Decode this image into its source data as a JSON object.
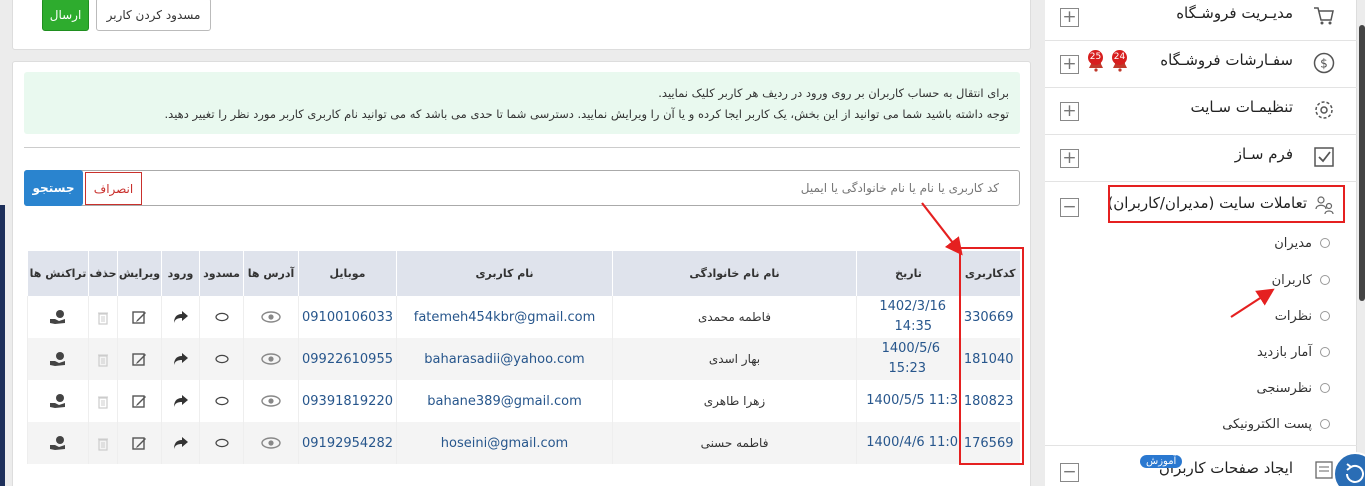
{
  "top": {
    "send_label": "ارسال",
    "block_label": "مسدود کردن کاربر"
  },
  "alert": {
    "line1": "برای انتقال به حساب کاربران بر روی ورود در ردیف هر کاربر کلیک نمایید.",
    "line2": "توجه داشته باشید شما می توانید از این بخش، یک کاربر ایجا کرده و یا آن را ویرایش نمایید. دسترسی شما تا حدی می باشد که می توانید نام کاربری کاربر مورد نظر را تغییر دهید."
  },
  "search": {
    "placeholder": "کد کاربری یا نام یا نام خانوادگی یا ایمیل",
    "cancel_label": "انصراف",
    "search_label": "جستجو"
  },
  "table": {
    "headers": [
      "کدکاربری",
      "تاریخ",
      "نام نام خانوادگی",
      "نام کاربری",
      "موبایل",
      "آدرس ها",
      "مسدود",
      "ورود",
      "ویرایش",
      "حذف",
      "تراکنش ها"
    ],
    "rows": [
      {
        "code": "330669",
        "date1": "1402/3/16",
        "date2": "14:35",
        "name": "فاطمه محمدی",
        "username": "fatemeh454kbr@gmail.com",
        "mobile": "09100106033"
      },
      {
        "code": "181040",
        "date1": "1400/5/6",
        "date2": "15:23",
        "name": "بهار اسدی",
        "username": "baharasadii@yahoo.com",
        "mobile": "09922610955"
      },
      {
        "code": "180823",
        "date1": "11:3 1400/5/5",
        "date2": "",
        "name": "زهرا طاهری",
        "username": "bahane389@gmail.com",
        "mobile": "09391819220"
      },
      {
        "code": "176569",
        "date1": "11:0 1400/4/6",
        "date2": "",
        "name": "فاطمه حسنی",
        "username": "hoseini@gmail.com",
        "mobile": "09192954282"
      }
    ]
  },
  "sidebar": {
    "items": [
      {
        "label": "مدیـریت فروشـگاه"
      },
      {
        "label": "سفـارشات فروشـگاه",
        "badge1": "24",
        "badge2": "25"
      },
      {
        "label": "تنظیمـات سـایت"
      },
      {
        "label": "فرم سـاز"
      },
      {
        "label": "تعاملات سایت (مدیران/کاربران)"
      }
    ],
    "sub_items": [
      "مدیران",
      "کاربران",
      "نظرات",
      "آمار بازدید",
      "نظرسنجی",
      "پست الکترونیکی"
    ],
    "last_item": {
      "label": "ایجاد صفحات کاربران",
      "badge": "آموزش"
    }
  },
  "colors": {
    "accent": "#2a84cf",
    "success": "#2eac2e",
    "annotation": "#e52020",
    "danger": "#c9302c"
  }
}
